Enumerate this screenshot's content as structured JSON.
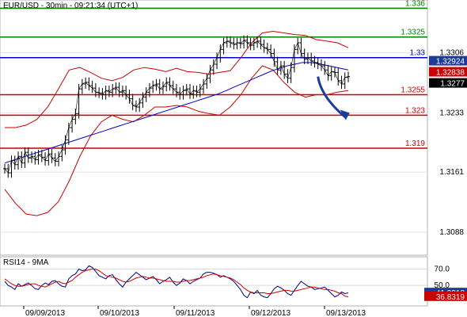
{
  "chart_data": [
    {
      "type": "candlestick",
      "title": "EUR/USD - 30min - 09:21:34 (UTC+1)",
      "ylim": [
        1.306,
        1.337
      ],
      "x_ticks": [
        "09/09/2013",
        "09/10/2013",
        "09/11/2013",
        "09/12/2013",
        "09/13/2013"
      ],
      "y_ticks": [
        "1.3088",
        "1.3161",
        "1.3233",
        "1.3306"
      ],
      "levels": [
        {
          "label": "1.336",
          "value": 1.336,
          "color": "#008000"
        },
        {
          "label": "1.3325",
          "value": 1.3325,
          "color": "#008000"
        },
        {
          "label": "1.33",
          "value": 1.33,
          "color": "#0000cc"
        },
        {
          "label": "1.3255",
          "value": 1.3255,
          "color": "#cc0000"
        },
        {
          "label": "1.323",
          "value": 1.323,
          "color": "#cc0000"
        },
        {
          "label": "1.319",
          "value": 1.319,
          "color": "#cc0000"
        }
      ],
      "price_tags": [
        {
          "label": "1.32924",
          "value": 1.32924,
          "color": "#1c3c9c"
        },
        {
          "label": "1.32838",
          "value": 1.32838,
          "color": "#cc0000"
        },
        {
          "label": "1.3277",
          "value": 1.3277,
          "color": "#000000"
        }
      ],
      "close": [
        1.3165,
        1.316,
        1.3175,
        1.317,
        1.318,
        1.3172,
        1.3185,
        1.3178,
        1.318,
        1.3176,
        1.3182,
        1.3179,
        1.3175,
        1.3183,
        1.3178,
        1.3174,
        1.318,
        1.3188,
        1.32,
        1.3215,
        1.3225,
        1.3232,
        1.3262,
        1.3268,
        1.327,
        1.3266,
        1.3263,
        1.3258,
        1.3257,
        1.3255,
        1.326,
        1.3258,
        1.3262,
        1.3264,
        1.3258,
        1.326,
        1.3255,
        1.325,
        1.3242,
        1.324,
        1.3245,
        1.3252,
        1.3258,
        1.3263,
        1.3266,
        1.3268,
        1.3262,
        1.3265,
        1.327,
        1.3266,
        1.3262,
        1.3258,
        1.3255,
        1.326,
        1.3262,
        1.3256,
        1.326,
        1.3258,
        1.3262,
        1.3268,
        1.3275,
        1.3285,
        1.3292,
        1.33,
        1.331,
        1.3318,
        1.332,
        1.3318,
        1.3316,
        1.3318,
        1.3317,
        1.3321,
        1.3318,
        1.3315,
        1.3318,
        1.332,
        1.3316,
        1.3312,
        1.331,
        1.3305,
        1.3295,
        1.3285,
        1.329,
        1.328,
        1.3275,
        1.3288,
        1.331,
        1.3318,
        1.3305,
        1.3298,
        1.33,
        1.3296,
        1.3294,
        1.3292,
        1.329,
        1.3285,
        1.3278,
        1.3283,
        1.3282,
        1.3272,
        1.3268,
        1.3276,
        1.3277
      ],
      "moving_average": [
        1.3172,
        1.3175,
        1.3178,
        1.3181,
        1.3184,
        1.3187,
        1.319,
        1.3193,
        1.3196,
        1.3199,
        1.3202,
        1.3205,
        1.3208,
        1.3211,
        1.3214,
        1.3217,
        1.322,
        1.3223,
        1.3226,
        1.3229,
        1.3232,
        1.3235,
        1.3238,
        1.3241,
        1.3244,
        1.3247,
        1.325,
        1.3253,
        1.3256,
        1.326,
        1.3264,
        1.3268,
        1.3272,
        1.3276,
        1.328,
        1.3284,
        1.3287,
        1.329,
        1.3292,
        1.3294,
        1.3294,
        1.3293,
        1.3291,
        1.3289,
        1.3287,
        1.3285
      ],
      "bollinger_upper": [
        1.3215,
        1.3215,
        1.3218,
        1.3225,
        1.324,
        1.3262,
        1.3285,
        1.3288,
        1.3282,
        1.3275,
        1.3272,
        1.3276,
        1.3285,
        1.3288,
        1.3286,
        1.3283,
        1.3287,
        1.3283,
        1.3282,
        1.328,
        1.3282,
        1.3284,
        1.33,
        1.3318,
        1.333,
        1.3332,
        1.333,
        1.3328,
        1.3327,
        1.3322,
        1.332,
        1.3318,
        1.3312
      ],
      "bollinger_lower": [
        1.314,
        1.3123,
        1.311,
        1.3108,
        1.3112,
        1.3125,
        1.315,
        1.318,
        1.3205,
        1.3222,
        1.323,
        1.3225,
        1.3222,
        1.323,
        1.324,
        1.324,
        1.3242,
        1.324,
        1.3235,
        1.3232,
        1.323,
        1.324,
        1.3255,
        1.3275,
        1.329,
        1.3285,
        1.327,
        1.3258,
        1.3252,
        1.3255,
        1.3255,
        1.3258,
        1.326
      ],
      "arrow": {
        "from": [
          93,
          1.3277
        ],
        "to": [
          101,
          1.3228
        ]
      }
    },
    {
      "type": "line",
      "title": "RSI14 - 9MA",
      "ylim": [
        25,
        85
      ],
      "y_ticks": [
        "70.0",
        "50.0"
      ],
      "series": [
        {
          "values": [
            55,
            50,
            48,
            45,
            52,
            49,
            51,
            53,
            50,
            46,
            45,
            50,
            53,
            51,
            55,
            56,
            52,
            49,
            48,
            58,
            62,
            64,
            70,
            68,
            69,
            74,
            72,
            67,
            62,
            60,
            58,
            62,
            63,
            57,
            52,
            48,
            54,
            58,
            62,
            66,
            63,
            60,
            57,
            59,
            61,
            57,
            52,
            55,
            57,
            60,
            54,
            50,
            53,
            58,
            56,
            52,
            55,
            57,
            59,
            64,
            66,
            66,
            65,
            63,
            60,
            62,
            60,
            58,
            55,
            50,
            45,
            38,
            35,
            42,
            40,
            44,
            38,
            36,
            35,
            40,
            46,
            49,
            47,
            44,
            40,
            38,
            44,
            50,
            55,
            52,
            49,
            48,
            45,
            46,
            47,
            48,
            44,
            40,
            36,
            38,
            42,
            40,
            41
          ],
          "color": "#000080"
        },
        {
          "values": [
            58,
            55,
            52,
            50,
            49,
            49,
            50,
            51,
            52,
            52,
            50,
            49,
            48,
            50,
            52,
            54,
            55,
            53,
            52,
            54,
            56,
            60,
            63,
            66,
            68,
            69,
            70,
            70,
            68,
            65,
            62,
            61,
            60,
            59,
            57,
            55,
            54,
            55,
            57,
            59,
            60,
            61,
            60,
            59,
            59,
            58,
            57,
            56,
            55,
            55,
            55,
            54,
            54,
            55,
            56,
            56,
            57,
            58,
            59,
            60,
            62,
            63,
            64,
            63,
            62,
            61,
            60,
            59,
            57,
            54,
            51,
            47,
            44,
            42,
            41,
            41,
            41,
            41,
            40,
            40,
            41,
            42,
            43,
            44,
            44,
            43,
            43,
            44,
            45,
            46,
            47,
            48,
            48,
            47,
            46,
            45,
            45,
            44,
            43,
            41,
            40,
            37,
            36
          ],
          "color": "#cc0000"
        }
      ],
      "price_tags": [
        {
          "label": "41.3318",
          "value": 41.3318,
          "color": "#1c3c9c"
        },
        {
          "label": "36.8319",
          "value": 36.8319,
          "color": "#cc0000"
        }
      ]
    }
  ]
}
